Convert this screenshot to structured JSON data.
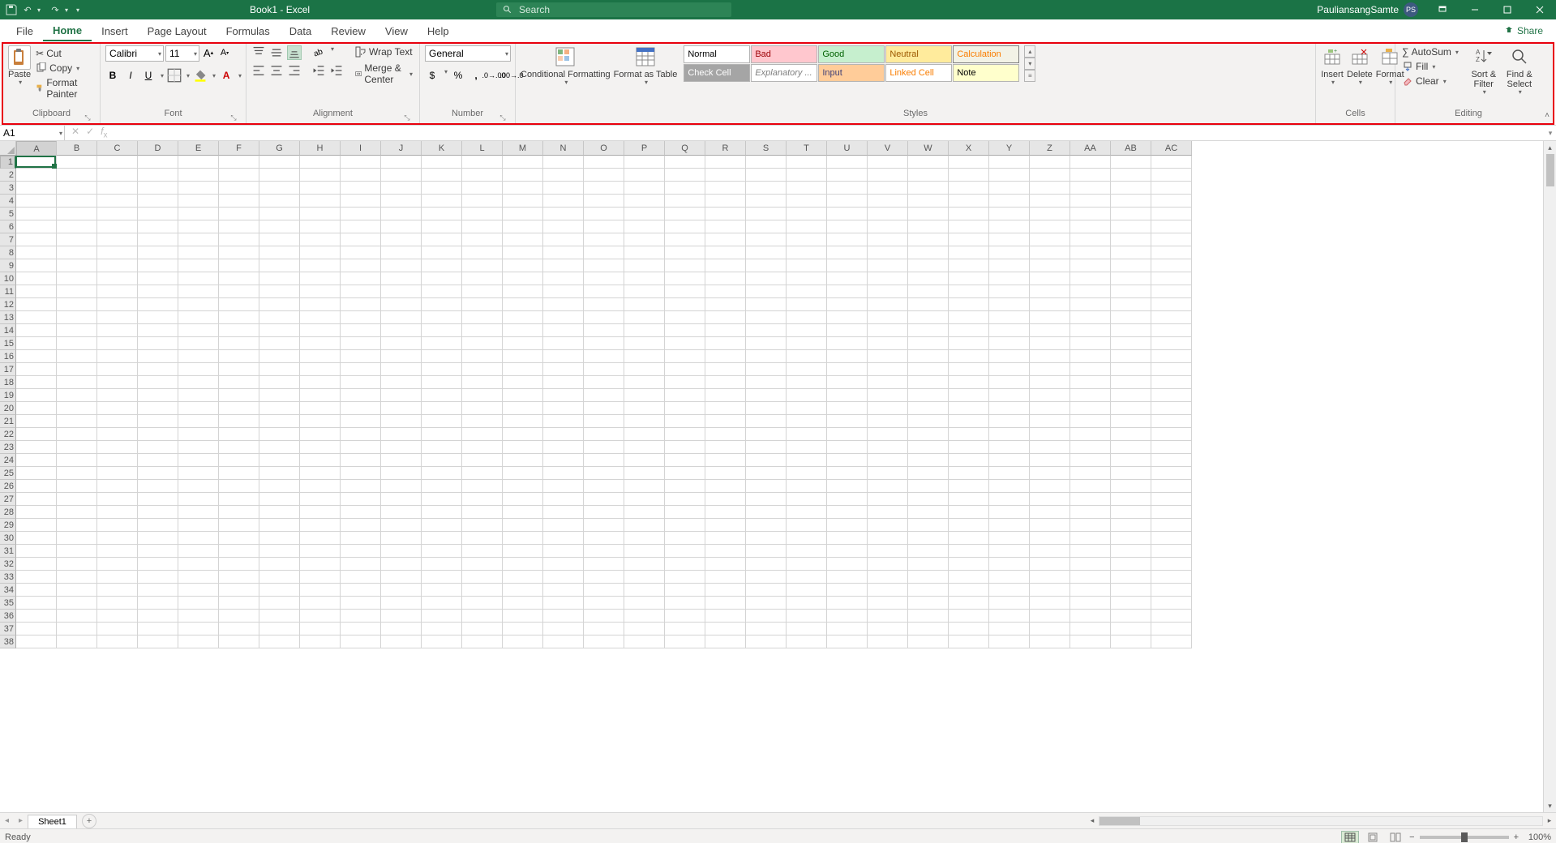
{
  "title": "Book1  -  Excel",
  "search_placeholder": "Search",
  "user": {
    "name": "PauliansangSamte",
    "initials": "PS"
  },
  "tabs": [
    "File",
    "Home",
    "Insert",
    "Page Layout",
    "Formulas",
    "Data",
    "Review",
    "View",
    "Help"
  ],
  "active_tab": "Home",
  "share": "Share",
  "ribbon": {
    "clipboard": {
      "paste": "Paste",
      "cut": "Cut",
      "copy": "Copy",
      "painter": "Format Painter",
      "label": "Clipboard"
    },
    "font": {
      "name": "Calibri",
      "size": "11",
      "label": "Font"
    },
    "alignment": {
      "wrap": "Wrap Text",
      "merge": "Merge & Center",
      "label": "Alignment"
    },
    "number": {
      "format": "General",
      "label": "Number"
    },
    "styles": {
      "cond": "Conditional Formatting",
      "fmt_table": "Format as Table",
      "cells": [
        "Normal",
        "Bad",
        "Good",
        "Neutral",
        "Calculation",
        "Check Cell",
        "Explanatory ...",
        "Input",
        "Linked Cell",
        "Note"
      ],
      "label": "Styles"
    },
    "cells": {
      "insert": "Insert",
      "delete": "Delete",
      "format": "Format",
      "label": "Cells"
    },
    "editing": {
      "autosum": "AutoSum",
      "fill": "Fill",
      "clear": "Clear",
      "sort": "Sort & Filter",
      "find": "Find & Select",
      "label": "Editing"
    }
  },
  "namebox": "A1",
  "sheet": {
    "name": "Sheet1"
  },
  "columns": [
    "A",
    "B",
    "C",
    "D",
    "E",
    "F",
    "G",
    "H",
    "I",
    "J",
    "K",
    "L",
    "M",
    "N",
    "O",
    "P",
    "Q",
    "R",
    "S",
    "T",
    "U",
    "V",
    "W",
    "X",
    "Y",
    "Z",
    "AA",
    "AB",
    "AC"
  ],
  "row_count": 38,
  "active_cell": {
    "col": 0,
    "row": 0
  },
  "status": "Ready",
  "zoom": "100%"
}
